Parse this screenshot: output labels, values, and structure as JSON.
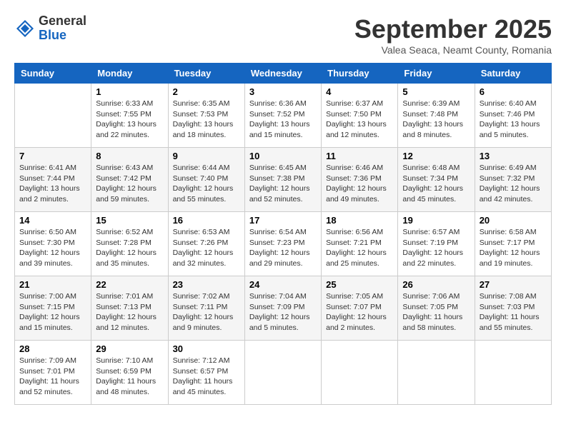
{
  "header": {
    "logo_general": "General",
    "logo_blue": "Blue",
    "month_title": "September 2025",
    "subtitle": "Valea Seaca, Neamt County, Romania"
  },
  "days_of_week": [
    "Sunday",
    "Monday",
    "Tuesday",
    "Wednesday",
    "Thursday",
    "Friday",
    "Saturday"
  ],
  "weeks": [
    [
      {
        "day": "",
        "info": ""
      },
      {
        "day": "1",
        "info": "Sunrise: 6:33 AM\nSunset: 7:55 PM\nDaylight: 13 hours\nand 22 minutes."
      },
      {
        "day": "2",
        "info": "Sunrise: 6:35 AM\nSunset: 7:53 PM\nDaylight: 13 hours\nand 18 minutes."
      },
      {
        "day": "3",
        "info": "Sunrise: 6:36 AM\nSunset: 7:52 PM\nDaylight: 13 hours\nand 15 minutes."
      },
      {
        "day": "4",
        "info": "Sunrise: 6:37 AM\nSunset: 7:50 PM\nDaylight: 13 hours\nand 12 minutes."
      },
      {
        "day": "5",
        "info": "Sunrise: 6:39 AM\nSunset: 7:48 PM\nDaylight: 13 hours\nand 8 minutes."
      },
      {
        "day": "6",
        "info": "Sunrise: 6:40 AM\nSunset: 7:46 PM\nDaylight: 13 hours\nand 5 minutes."
      }
    ],
    [
      {
        "day": "7",
        "info": "Sunrise: 6:41 AM\nSunset: 7:44 PM\nDaylight: 13 hours\nand 2 minutes."
      },
      {
        "day": "8",
        "info": "Sunrise: 6:43 AM\nSunset: 7:42 PM\nDaylight: 12 hours\nand 59 minutes."
      },
      {
        "day": "9",
        "info": "Sunrise: 6:44 AM\nSunset: 7:40 PM\nDaylight: 12 hours\nand 55 minutes."
      },
      {
        "day": "10",
        "info": "Sunrise: 6:45 AM\nSunset: 7:38 PM\nDaylight: 12 hours\nand 52 minutes."
      },
      {
        "day": "11",
        "info": "Sunrise: 6:46 AM\nSunset: 7:36 PM\nDaylight: 12 hours\nand 49 minutes."
      },
      {
        "day": "12",
        "info": "Sunrise: 6:48 AM\nSunset: 7:34 PM\nDaylight: 12 hours\nand 45 minutes."
      },
      {
        "day": "13",
        "info": "Sunrise: 6:49 AM\nSunset: 7:32 PM\nDaylight: 12 hours\nand 42 minutes."
      }
    ],
    [
      {
        "day": "14",
        "info": "Sunrise: 6:50 AM\nSunset: 7:30 PM\nDaylight: 12 hours\nand 39 minutes."
      },
      {
        "day": "15",
        "info": "Sunrise: 6:52 AM\nSunset: 7:28 PM\nDaylight: 12 hours\nand 35 minutes."
      },
      {
        "day": "16",
        "info": "Sunrise: 6:53 AM\nSunset: 7:26 PM\nDaylight: 12 hours\nand 32 minutes."
      },
      {
        "day": "17",
        "info": "Sunrise: 6:54 AM\nSunset: 7:23 PM\nDaylight: 12 hours\nand 29 minutes."
      },
      {
        "day": "18",
        "info": "Sunrise: 6:56 AM\nSunset: 7:21 PM\nDaylight: 12 hours\nand 25 minutes."
      },
      {
        "day": "19",
        "info": "Sunrise: 6:57 AM\nSunset: 7:19 PM\nDaylight: 12 hours\nand 22 minutes."
      },
      {
        "day": "20",
        "info": "Sunrise: 6:58 AM\nSunset: 7:17 PM\nDaylight: 12 hours\nand 19 minutes."
      }
    ],
    [
      {
        "day": "21",
        "info": "Sunrise: 7:00 AM\nSunset: 7:15 PM\nDaylight: 12 hours\nand 15 minutes."
      },
      {
        "day": "22",
        "info": "Sunrise: 7:01 AM\nSunset: 7:13 PM\nDaylight: 12 hours\nand 12 minutes."
      },
      {
        "day": "23",
        "info": "Sunrise: 7:02 AM\nSunset: 7:11 PM\nDaylight: 12 hours\nand 9 minutes."
      },
      {
        "day": "24",
        "info": "Sunrise: 7:04 AM\nSunset: 7:09 PM\nDaylight: 12 hours\nand 5 minutes."
      },
      {
        "day": "25",
        "info": "Sunrise: 7:05 AM\nSunset: 7:07 PM\nDaylight: 12 hours\nand 2 minutes."
      },
      {
        "day": "26",
        "info": "Sunrise: 7:06 AM\nSunset: 7:05 PM\nDaylight: 11 hours\nand 58 minutes."
      },
      {
        "day": "27",
        "info": "Sunrise: 7:08 AM\nSunset: 7:03 PM\nDaylight: 11 hours\nand 55 minutes."
      }
    ],
    [
      {
        "day": "28",
        "info": "Sunrise: 7:09 AM\nSunset: 7:01 PM\nDaylight: 11 hours\nand 52 minutes."
      },
      {
        "day": "29",
        "info": "Sunrise: 7:10 AM\nSunset: 6:59 PM\nDaylight: 11 hours\nand 48 minutes."
      },
      {
        "day": "30",
        "info": "Sunrise: 7:12 AM\nSunset: 6:57 PM\nDaylight: 11 hours\nand 45 minutes."
      },
      {
        "day": "",
        "info": ""
      },
      {
        "day": "",
        "info": ""
      },
      {
        "day": "",
        "info": ""
      },
      {
        "day": "",
        "info": ""
      }
    ]
  ]
}
